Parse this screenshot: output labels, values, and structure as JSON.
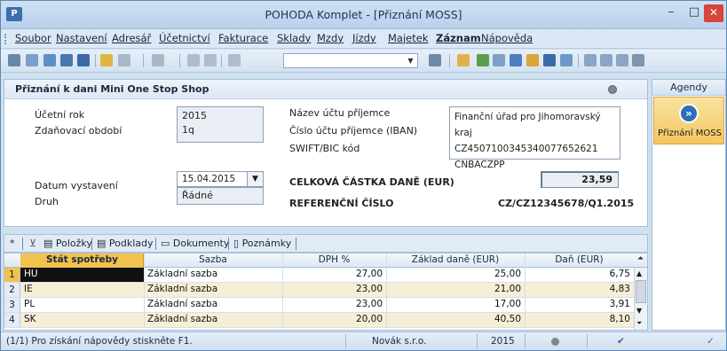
{
  "window": {
    "title": "POHODA Komplet - [Přiznání MOSS]",
    "min_glyph": "–",
    "max_glyph": "□",
    "close_glyph": "✕"
  },
  "menu": [
    "Soubor",
    "Nastavení",
    "Adresář",
    "Účetnictví",
    "Fakturace",
    "Sklady",
    "Mzdy",
    "Jízdy",
    "Majetek",
    "Záznam",
    "Nápověda"
  ],
  "form": {
    "title": "Přiznání k dani Mini One Stop Shop",
    "ucetni_rok_label": "Účetní rok",
    "ucetni_rok": "2015",
    "zdanovaci_obdobi_label": "Zdaňovací období",
    "zdanovaci_obdobi": "1q",
    "nazev_uctu_label": "Název účtu příjemce",
    "nazev_uctu": "Finanční úřad pro Jihomoravský kraj",
    "cislo_uctu_label": "Číslo účtu příjemce (IBAN)",
    "cislo_uctu": "CZ4507100345340077652621",
    "swift_label": "SWIFT/BIC kód",
    "swift": "CNBACZPP",
    "datum_label": "Datum vystavení",
    "datum": "15.04.2015",
    "druh_label": "Druh",
    "druh": "Řádné",
    "celkova_castka_label": "CELKOVÁ ČÁSTKA DANĚ (EUR)",
    "celkova_castka": "23,59",
    "referencni_cislo_label": "REFERENČNÍ ČÍSLO",
    "referencni_cislo": "CZ/CZ12345678/Q1.2015"
  },
  "tabs": {
    "star": "*",
    "polozky": "Položky",
    "podklady": "Podklady",
    "dokumenty": "Dokumenty",
    "poznamky": "Poznámky"
  },
  "grid": {
    "headers": [
      "Stát spotřeby",
      "Sazba",
      "DPH %",
      "Základ daně (EUR)",
      "Daň (EUR)"
    ],
    "rows": [
      {
        "num": "1",
        "stat": "HU",
        "sazba": "Základní sazba",
        "dph": "27,00",
        "zaklad": "25,00",
        "dan": "6,75"
      },
      {
        "num": "2",
        "stat": "IE",
        "sazba": "Základní sazba",
        "dph": "23,00",
        "zaklad": "21,00",
        "dan": "4,83"
      },
      {
        "num": "3",
        "stat": "PL",
        "sazba": "Základní sazba",
        "dph": "23,00",
        "zaklad": "17,00",
        "dan": "3,91"
      },
      {
        "num": "4",
        "stat": "SK",
        "sazba": "Základní sazba",
        "dph": "20,00",
        "zaklad": "40,50",
        "dan": "8,10"
      }
    ]
  },
  "agendy": {
    "header": "Agendy",
    "item": "Přiznání MOSS"
  },
  "status": {
    "help": "(1/1) Pro získání nápovědy stiskněte F1.",
    "company": "Novák s.r.o.",
    "year": "2015"
  },
  "colors": {
    "accent": "#f3c24e",
    "close": "#d9443b"
  }
}
